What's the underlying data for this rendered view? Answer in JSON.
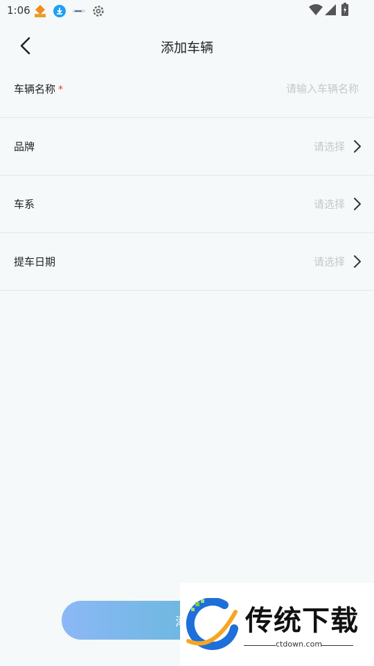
{
  "status_bar": {
    "time": "1:06"
  },
  "header": {
    "title": "添加车辆"
  },
  "form": {
    "vehicle_name": {
      "label": "车辆名称",
      "required_mark": "*",
      "placeholder": "请输入车辆名称",
      "value": ""
    },
    "brand": {
      "label": "品牌",
      "value": "请选择"
    },
    "series": {
      "label": "车系",
      "value": "请选择"
    },
    "pickup_date": {
      "label": "提车日期",
      "value": "请选择"
    }
  },
  "submit": {
    "label": "添加"
  },
  "watermark": {
    "text": "传统下载",
    "url": "ctdown.com"
  },
  "colors": {
    "background": "#f6f9f9",
    "required": "#e53935",
    "placeholder": "#c4c8c8",
    "button_gradient_start": "#8cb8f6",
    "button_gradient_end": "#4eb7c9"
  },
  "icons": [
    "orange-app-icon",
    "download-icon",
    "notification-app-icon",
    "settings-icon",
    "wifi-icon",
    "signal-icon",
    "battery-icon",
    "back-arrow-icon",
    "chevron-right-icon"
  ]
}
